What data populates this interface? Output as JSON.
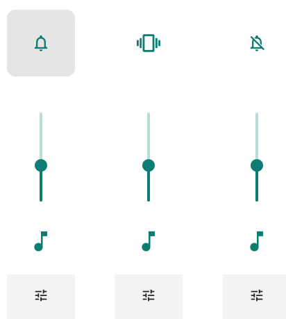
{
  "colors": {
    "accent": "#0b7d73",
    "track": "#b9dcd9",
    "selected_bg": "#e5e5e5",
    "settings_bg": "#f3f3f3",
    "settings_icon": "#222222"
  },
  "ringer_modes": [
    {
      "icon": "bell-icon",
      "selected": true
    },
    {
      "icon": "vibrate-icon",
      "selected": false
    },
    {
      "icon": "bell-off-icon",
      "selected": false
    }
  ],
  "volume_streams": [
    {
      "icon": "music-note-icon",
      "level": 0.41
    },
    {
      "icon": "music-note-icon",
      "level": 0.41
    },
    {
      "icon": "music-note-icon",
      "level": 0.41
    }
  ],
  "settings_buttons": [
    {
      "icon": "tune-icon"
    },
    {
      "icon": "tune-icon"
    },
    {
      "icon": "tune-icon"
    }
  ]
}
